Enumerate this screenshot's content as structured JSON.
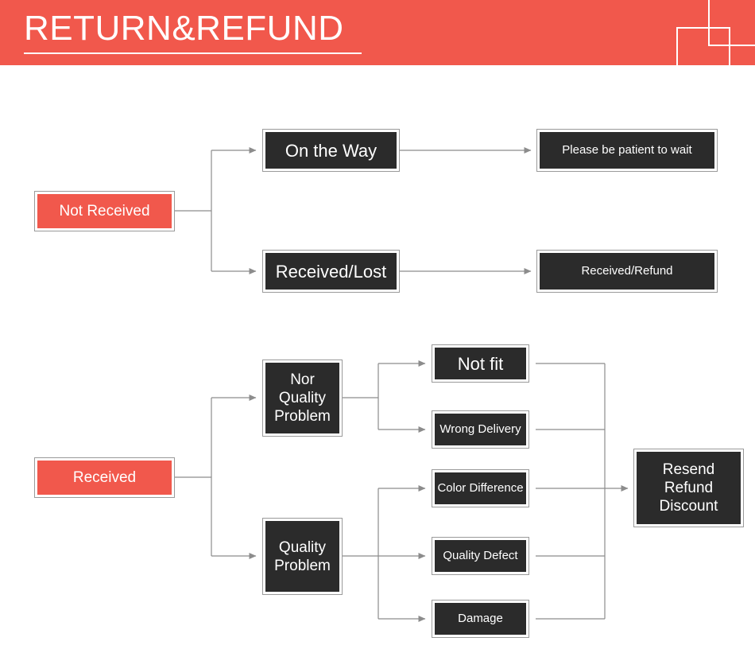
{
  "header": {
    "title": "RETURN&REFUND",
    "background_color": "#f1584c",
    "text_color": "#ffffff",
    "decor": {
      "square_large": "decorative-outline-square",
      "square_small": "decorative-outline-square"
    }
  },
  "theme": {
    "accent_red": "#f1584c",
    "node_dark": "#2b2b2b",
    "node_border": "#9a9a9a",
    "connector": "#8c8c8c",
    "page_background": "#ffffff"
  },
  "flow": {
    "branch_not_received": {
      "root": {
        "label": "Not Received",
        "style": "red"
      },
      "steps": [
        {
          "label": "On the Way",
          "style": "dark",
          "outcome": "Please be patient to wait"
        },
        {
          "label": "Received/Lost",
          "style": "dark",
          "outcome": "Received/Refund"
        }
      ]
    },
    "branch_received": {
      "root": {
        "label": "Received",
        "style": "red"
      },
      "categories": [
        {
          "label": "Nor\nQuality\nProblem",
          "style": "dark",
          "reasons": [
            "Not fit",
            "Wrong Delivery"
          ]
        },
        {
          "label": "Quality\nProblem",
          "style": "dark",
          "reasons": [
            "Color Difference",
            "Quality Defect",
            "Damage"
          ]
        }
      ],
      "resolution": {
        "label": "Resend\nRefund\nDiscount",
        "style": "dark"
      }
    }
  },
  "nodes": {
    "not_received": "Not Received",
    "on_the_way": "On the Way",
    "please_be_patient": "Please be patient to wait",
    "received_lost": "Received/Lost",
    "received_refund": "Received/Refund",
    "received": "Received",
    "nor_quality_problem": "Nor\nQuality\nProblem",
    "quality_problem": "Quality\nProblem",
    "not_fit": "Not fit",
    "wrong_delivery": "Wrong Delivery",
    "color_difference": "Color Difference",
    "quality_defect": "Quality Defect",
    "damage": "Damage",
    "resend_refund_discount": "Resend\nRefund\nDiscount"
  }
}
